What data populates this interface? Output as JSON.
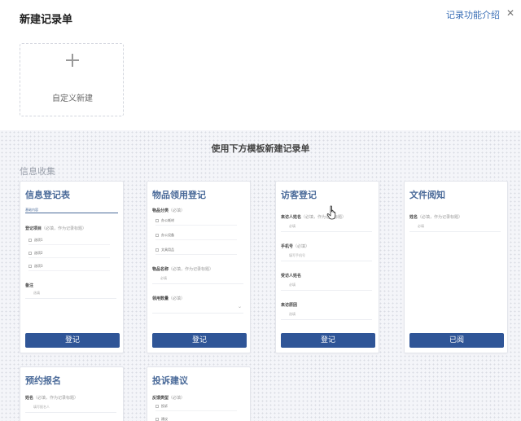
{
  "header": {
    "title": "新建记录单",
    "help_link": "记录功能介绍",
    "close_glyph": "✕"
  },
  "custom": {
    "label": "自定义新建"
  },
  "templates_heading": "使用下方模板新建记录单",
  "group": {
    "label": "信息收集"
  },
  "cards": {
    "info_register": {
      "title": "信息登记表",
      "tab": "基础内容",
      "reg_label": "登记项目",
      "reg_hint": "（必填，作为记录标题）",
      "options": [
        "选项1",
        "选项2",
        "选项3"
      ],
      "remark_label": "备注",
      "remark_placeholder": "选填",
      "button": "登记"
    },
    "item_usage": {
      "title": "物品领用登记",
      "cat_label": "物品分类",
      "cat_hint": "（必填）",
      "options": [
        "办公耗材",
        "办公设备",
        "文具用品"
      ],
      "name_label": "物品名称",
      "name_hint": "（必填，作为记录标题）",
      "name_placeholder": "必填",
      "qty_label": "领用数量",
      "qty_hint": "（必填）",
      "button": "登记"
    },
    "visitor": {
      "title": "访客登记",
      "name_label": "来访人姓名",
      "name_hint": "（必填，作为记录标题）",
      "name_placeholder": "必填",
      "phone_label": "手机号",
      "phone_hint": "（必填）",
      "phone_placeholder": "填写手机号",
      "host_label": "受访人姓名",
      "host_placeholder": "必填",
      "reason_label": "来访原因",
      "reason_placeholder": "选填",
      "button": "登记"
    },
    "doc_read": {
      "title": "文件阅知",
      "doc_label": "姓名",
      "doc_hint": "（必填，作为记录标题）",
      "doc_placeholder": "必填",
      "button": "已阅"
    },
    "registration": {
      "title": "预约报名",
      "name_label": "姓名",
      "name_hint": "（必填，作为记录标题）",
      "name_placeholder": "填写报名人"
    },
    "complaint": {
      "title": "投诉建议",
      "type_label": "反馈类型",
      "type_hint": "（必填）",
      "options": [
        "投诉",
        "建议"
      ]
    }
  },
  "colors": {
    "accent": "#2f5597",
    "title_blue": "#4a6a99",
    "link": "#3b6fb6"
  }
}
